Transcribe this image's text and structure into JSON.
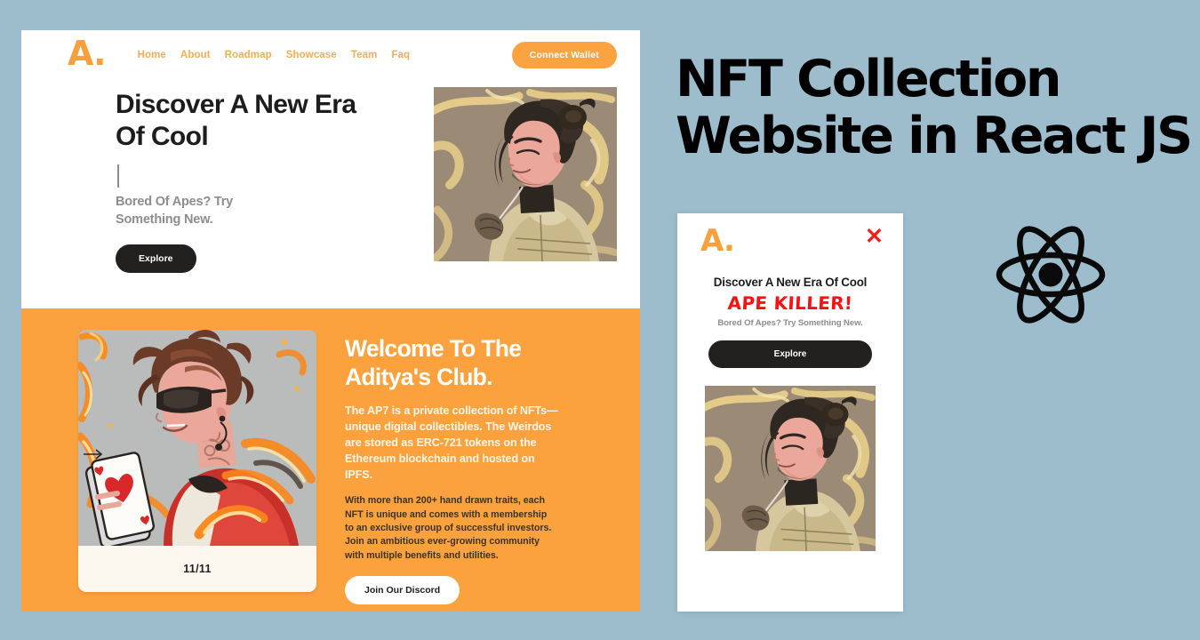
{
  "page": {
    "background_color": "#9dbdcd",
    "accent_orange": "#fba23e",
    "accent_orange_light": "#f9ab54",
    "dark": "#23211f",
    "red": "#fb1111"
  },
  "headline": {
    "line1": "NFT Collection",
    "line2": "Website in React JS"
  },
  "desktop": {
    "navbar": {
      "logo": "A.",
      "links": [
        {
          "label": "Home"
        },
        {
          "label": "About"
        },
        {
          "label": "Roadmap"
        },
        {
          "label": "Showcase"
        },
        {
          "label": "Team"
        },
        {
          "label": "Faq"
        }
      ],
      "connect_wallet_label": "Connect Wallet"
    },
    "hero": {
      "title": "Discover A New Era Of Cool",
      "typing_caret": "|",
      "subtitle": "Bored Of Apes? Try Something New.",
      "cta_label": "Explore",
      "artwork_name": "samurai-nft-artwork"
    },
    "welcome": {
      "title": "Welcome To The Aditya's Club.",
      "paragraph_1": "The AP7 is a private collection of NFTs—unique digital collectibles. The Weirdos are stored as ERC-721 tokens on the Ethereum blockchain and hosted on IPFS.",
      "paragraph_2": "With more than 200+ hand drawn traits, each NFT is unique and comes with a membership to an exclusive group of successful investors. Join an ambitious ever-growing community with multiple benefits and utilities.",
      "cta_label": "Join Our Discord",
      "card": {
        "label": "11/11",
        "artwork_name": "card-dealer-nft-artwork"
      }
    }
  },
  "mobile": {
    "logo": "A.",
    "close_icon": "✕",
    "heading": "Discover A New Era Of Cool",
    "highlight": "APE KILLER!",
    "subtitle": "Bored Of Apes? Try Something New.",
    "cta_label": "Explore",
    "artwork_name": "samurai-nft-artwork"
  },
  "react_logo": {
    "icon_name": "react-atom-logo",
    "color": "#0a0a0a"
  }
}
